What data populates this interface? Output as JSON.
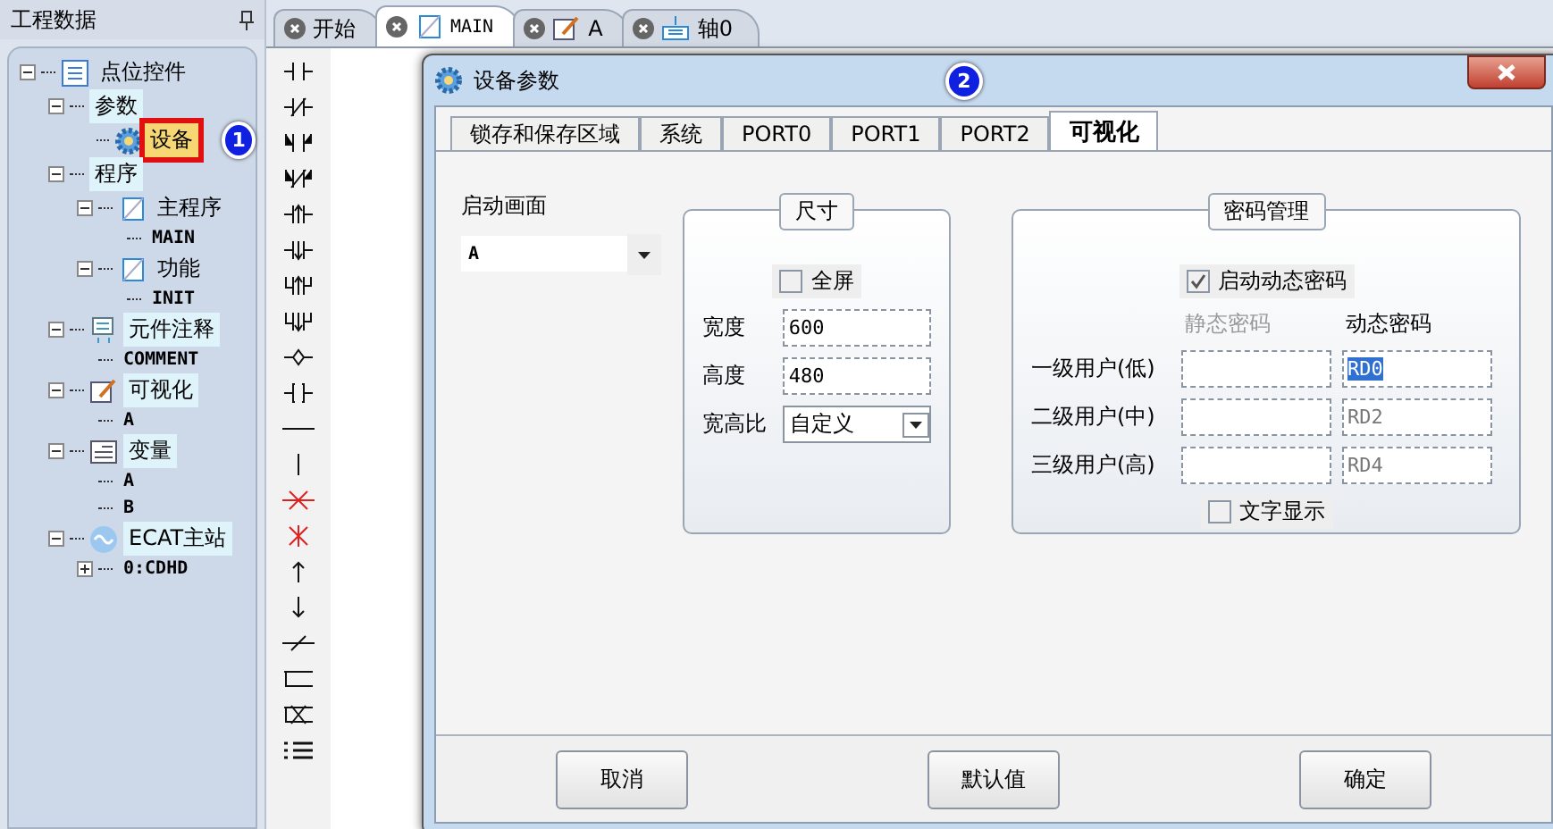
{
  "sidebar": {
    "title": "工程数据",
    "tree": [
      {
        "label": "点位控件",
        "kind": "root",
        "expanded": true,
        "highlighted": false,
        "children": [
          {
            "label": "参数",
            "kind": "plain",
            "expanded": true,
            "highlighted": true,
            "children": [
              {
                "label": "设备",
                "kind": "gear",
                "selected": true,
                "badge": "1"
              }
            ]
          },
          {
            "label": "程序",
            "kind": "plain",
            "expanded": true,
            "highlighted": true,
            "children": [
              {
                "label": "主程序",
                "kind": "program",
                "expanded": true,
                "highlighted": false,
                "children": [
                  {
                    "label": "MAIN",
                    "kind": "leaf"
                  }
                ]
              },
              {
                "label": "功能",
                "kind": "program",
                "expanded": true,
                "highlighted": false,
                "children": [
                  {
                    "label": "INIT",
                    "kind": "leaf"
                  }
                ]
              }
            ]
          },
          {
            "label": "元件注释",
            "kind": "comment",
            "expanded": true,
            "highlighted": true,
            "children": [
              {
                "label": "COMMENT",
                "kind": "leaf"
              }
            ]
          },
          {
            "label": "可视化",
            "kind": "visual",
            "expanded": true,
            "highlighted": true,
            "children": [
              {
                "label": "A",
                "kind": "leaf"
              }
            ]
          },
          {
            "label": "变量",
            "kind": "variable",
            "expanded": true,
            "highlighted": true,
            "children": [
              {
                "label": "A",
                "kind": "leaf"
              },
              {
                "label": "B",
                "kind": "leaf"
              }
            ]
          },
          {
            "label": "ECAT主站",
            "kind": "ecat",
            "expanded": true,
            "highlighted": true,
            "children": [
              {
                "label": "0:CDHD",
                "kind": "leaf",
                "expanded": false
              }
            ]
          }
        ]
      }
    ]
  },
  "tabs": [
    {
      "label": "开始",
      "kind": "plain",
      "selected": false
    },
    {
      "label": "MAIN",
      "kind": "program",
      "selected": true
    },
    {
      "label": "A",
      "kind": "visual",
      "selected": false
    },
    {
      "label": "轴0",
      "kind": "axis",
      "selected": false
    }
  ],
  "dialog": {
    "title": "设备参数",
    "badge": "2",
    "tabs": [
      {
        "label": "锁存和保存区域",
        "selected": false
      },
      {
        "label": "系统",
        "selected": false
      },
      {
        "label": "PORT0",
        "selected": false
      },
      {
        "label": "PORT1",
        "selected": false
      },
      {
        "label": "PORT2",
        "selected": false
      },
      {
        "label": "可视化",
        "selected": true
      }
    ],
    "start_screen": {
      "label": "启动画面",
      "value": "A"
    },
    "size": {
      "title": "尺寸",
      "fullscreen": {
        "label": "全屏",
        "checked": false
      },
      "width": {
        "label": "宽度",
        "value": "600"
      },
      "height": {
        "label": "高度",
        "value": "480"
      },
      "ratio": {
        "label": "宽高比",
        "value": "自定义"
      }
    },
    "password": {
      "title": "密码管理",
      "dynamic_enabled": {
        "label": "启动动态密码",
        "checked": true
      },
      "static_header": "静态密码",
      "dynamic_header": "动态密码",
      "static_enabled": false,
      "rows": [
        {
          "label": "一级用户(低)",
          "dynamic": "RD0",
          "selected": true
        },
        {
          "label": "二级用户(中)",
          "dynamic": "RD2",
          "selected": false
        },
        {
          "label": "三级用户(高)",
          "dynamic": "RD4",
          "selected": false
        }
      ],
      "show_text": {
        "label": "文字显示",
        "checked": false
      }
    },
    "buttons": [
      "取消",
      "默认值",
      "确定"
    ]
  }
}
